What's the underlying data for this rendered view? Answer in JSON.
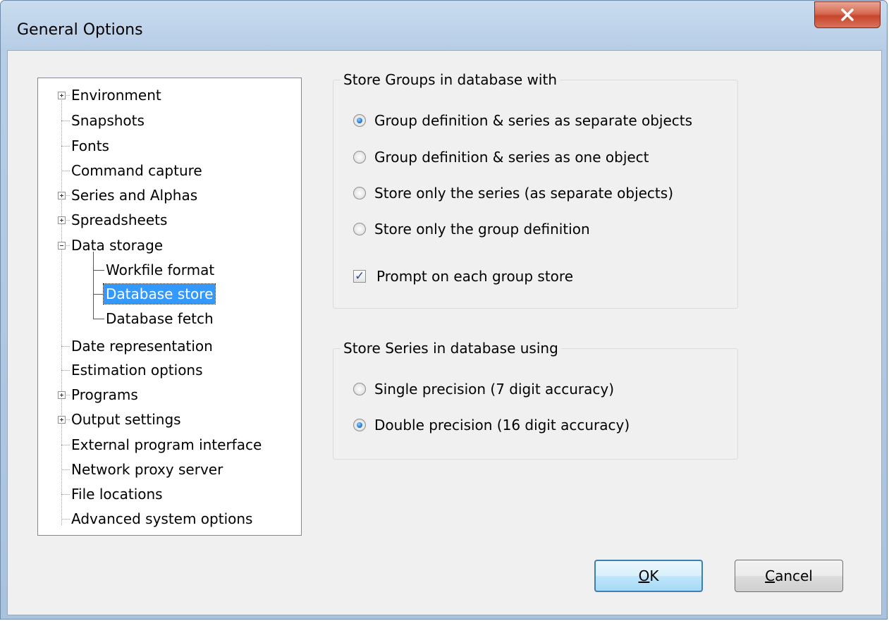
{
  "window": {
    "title": "General Options",
    "close_label": "X"
  },
  "tree": {
    "items": [
      {
        "label": "Environment"
      },
      {
        "label": "Snapshots"
      },
      {
        "label": "Fonts"
      },
      {
        "label": "Command capture"
      },
      {
        "label": "Series and Alphas"
      },
      {
        "label": "Spreadsheets"
      },
      {
        "label": "Data storage"
      },
      {
        "label": "Workfile format"
      },
      {
        "label": "Database store"
      },
      {
        "label": "Database fetch"
      },
      {
        "label": "Date representation"
      },
      {
        "label": "Estimation options"
      },
      {
        "label": "Programs"
      },
      {
        "label": "Output settings"
      },
      {
        "label": "External program interface"
      },
      {
        "label": "Network proxy server"
      },
      {
        "label": "File locations"
      },
      {
        "label": "Advanced system options"
      }
    ],
    "selected": "Database store"
  },
  "groups_panel": {
    "title": "Store Groups in database with",
    "options": [
      {
        "label": "Group definition & series as separate objects",
        "checked": true
      },
      {
        "label": "Group definition & series as one object",
        "checked": false
      },
      {
        "label": "Store only the series (as separate objects)",
        "checked": false
      },
      {
        "label": "Store only the group definition",
        "checked": false
      }
    ],
    "prompt_checkbox": {
      "label": "Prompt on each group store",
      "checked": true
    }
  },
  "series_panel": {
    "title": "Store Series in database using",
    "options": [
      {
        "label": "Single precision  (7 digit accuracy)",
        "checked": false
      },
      {
        "label": "Double precision  (16 digit accuracy)",
        "checked": true
      }
    ]
  },
  "buttons": {
    "ok_mnemonic": "O",
    "ok_rest": "K",
    "cancel_mnemonic": "C",
    "cancel_rest": "ancel"
  }
}
